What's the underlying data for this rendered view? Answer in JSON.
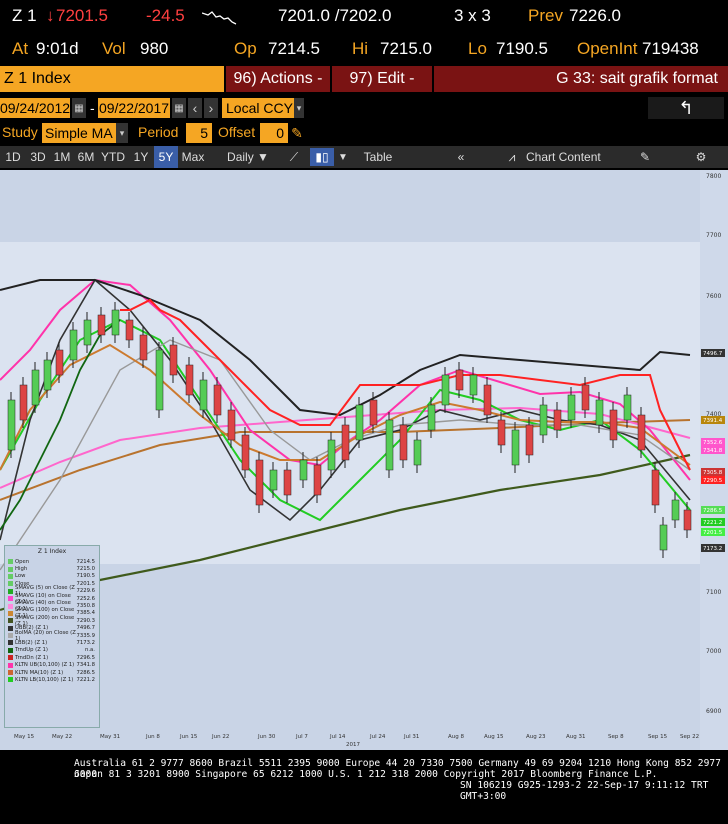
{
  "quote": {
    "ticker": "Z 1",
    "arrow": "↓",
    "last": "7201.5",
    "change": "-24.5",
    "bid_ask": "7201.0 /7202.0",
    "size": "3 x 3",
    "prev_label": "Prev",
    "prev": "7226.0",
    "at_label": "At",
    "at_time": "9:01d",
    "vol_label": "Vol",
    "vol": "980",
    "op_label": "Op",
    "op": "7214.5",
    "hi_label": "Hi",
    "hi": "7215.0",
    "lo_label": "Lo",
    "lo": "7190.5",
    "oi_label": "OpenInt",
    "oi": "719438"
  },
  "menubar": {
    "security": "Z 1 Index",
    "actions": "96) Actions -",
    "edit": "97) Edit -",
    "title": "G 33: sait grafik format"
  },
  "dates": {
    "start": "09/24/2012",
    "sep": "-",
    "end": "09/22/2017",
    "currency": "Local CCY"
  },
  "study": {
    "label": "Study",
    "value": "Simple MA",
    "period_label": "Period",
    "period": "5",
    "offset_label": "Offset",
    "offset": "0"
  },
  "toolbar": {
    "ranges": [
      "1D",
      "3D",
      "1M",
      "6M",
      "YTD",
      "1Y",
      "5Y",
      "Max"
    ],
    "active_range": "5Y",
    "freq": "Daily",
    "table": "Table",
    "chart_content": "Chart Content"
  },
  "chart": {
    "y_ticks": [
      "7800",
      "7700",
      "7600",
      "7500",
      "7400",
      "7300",
      "7200",
      "7100",
      "7000",
      "6900"
    ],
    "x_ticks": [
      "May 15",
      "May 22",
      "May 31",
      "Jun 8",
      "Jun 15",
      "Jun 22",
      "Jun 30",
      "Jul 7",
      "Jul 14",
      "Jul 24",
      "Jul 31",
      "Aug 8",
      "Aug 15",
      "Aug 23",
      "Aug 31",
      "Sep 8",
      "Sep 15",
      "Sep 22"
    ],
    "year": "2017",
    "tags": [
      {
        "text": "7496.7",
        "color": "#333333"
      },
      {
        "text": "7391.4",
        "color": "#b8860b"
      },
      {
        "text": "7352.6",
        "color": "#ff55cc"
      },
      {
        "text": "7341.8",
        "color": "#ff55cc"
      },
      {
        "text": "7305.8",
        "color": "#cc3333"
      },
      {
        "text": "7290.5",
        "color": "#ff2222"
      },
      {
        "text": "7286.5",
        "color": "#55dd55"
      },
      {
        "text": "7221.2",
        "color": "#22cc22"
      },
      {
        "text": "7201.5",
        "color": "#44ee44"
      },
      {
        "text": "7173.2",
        "color": "#333333"
      }
    ]
  },
  "legend": {
    "title": "Z 1 Index",
    "items": [
      {
        "label": "Open",
        "value": "7214.5",
        "color": "#66cc66"
      },
      {
        "label": "High",
        "value": "7215.0",
        "color": "#66cc66"
      },
      {
        "label": "Low",
        "value": "7190.5",
        "color": "#66cc66"
      },
      {
        "label": "Close",
        "value": "7201.5",
        "color": "#66cc66"
      },
      {
        "label": "SMAVG (5) on Close (Z 1)",
        "value": "7229.6",
        "color": "#22aa22"
      },
      {
        "label": "SMAVG (10) on Close (Z 1)",
        "value": "7252.6",
        "color": "#ff44cc"
      },
      {
        "label": "SMAVG (40) on Close (Z 1)",
        "value": "7350.8",
        "color": "#ff88dd"
      },
      {
        "label": "SMAVG (100) on Close (Z 1)",
        "value": "7385.4",
        "color": "#cc8833"
      },
      {
        "label": "SMAVG (200) on Close (Z 1)",
        "value": "7290.3",
        "color": "#445522"
      },
      {
        "label": "UBB(2) (Z 1)",
        "value": "7496.7",
        "color": "#333333"
      },
      {
        "label": "BolMA (20) on Close (Z 1)",
        "value": "7335.9",
        "color": "#aaaaaa"
      },
      {
        "label": "LBB(2) (Z 1)",
        "value": "7173.2",
        "color": "#333333"
      },
      {
        "label": "TrndUp (Z 1)",
        "value": "n.a.",
        "color": "#116611"
      },
      {
        "label": "TrndDn (Z 1)",
        "value": "7296.5",
        "color": "#cc2222"
      },
      {
        "label": "KLTN UB(10,100) (Z 1)",
        "value": "7341.8",
        "color": "#ff33aa"
      },
      {
        "label": "KLTN MA(10) (Z 1)",
        "value": "7286.5",
        "color": "#cc6633"
      },
      {
        "label": "KLTN LB(10,100) (Z 1)",
        "value": "7221.2",
        "color": "#22cc22"
      }
    ]
  },
  "footer": {
    "line1": "Australia 61 2 9777 8600 Brazil 5511 2395 9000 Europe 44 20 7330 7500 Germany 49 69 9204 1210 Hong Kong 852 2977 6000",
    "line2": "Japan 81 3 3201 8900        Singapore 65 6212 1000      U.S. 1 212 318 2000          Copyright 2017 Bloomberg Finance L.P.",
    "line3": "SN 106219 G925-1293-2 22-Sep-17  9:11:12 TRT  GMT+3:00"
  }
}
